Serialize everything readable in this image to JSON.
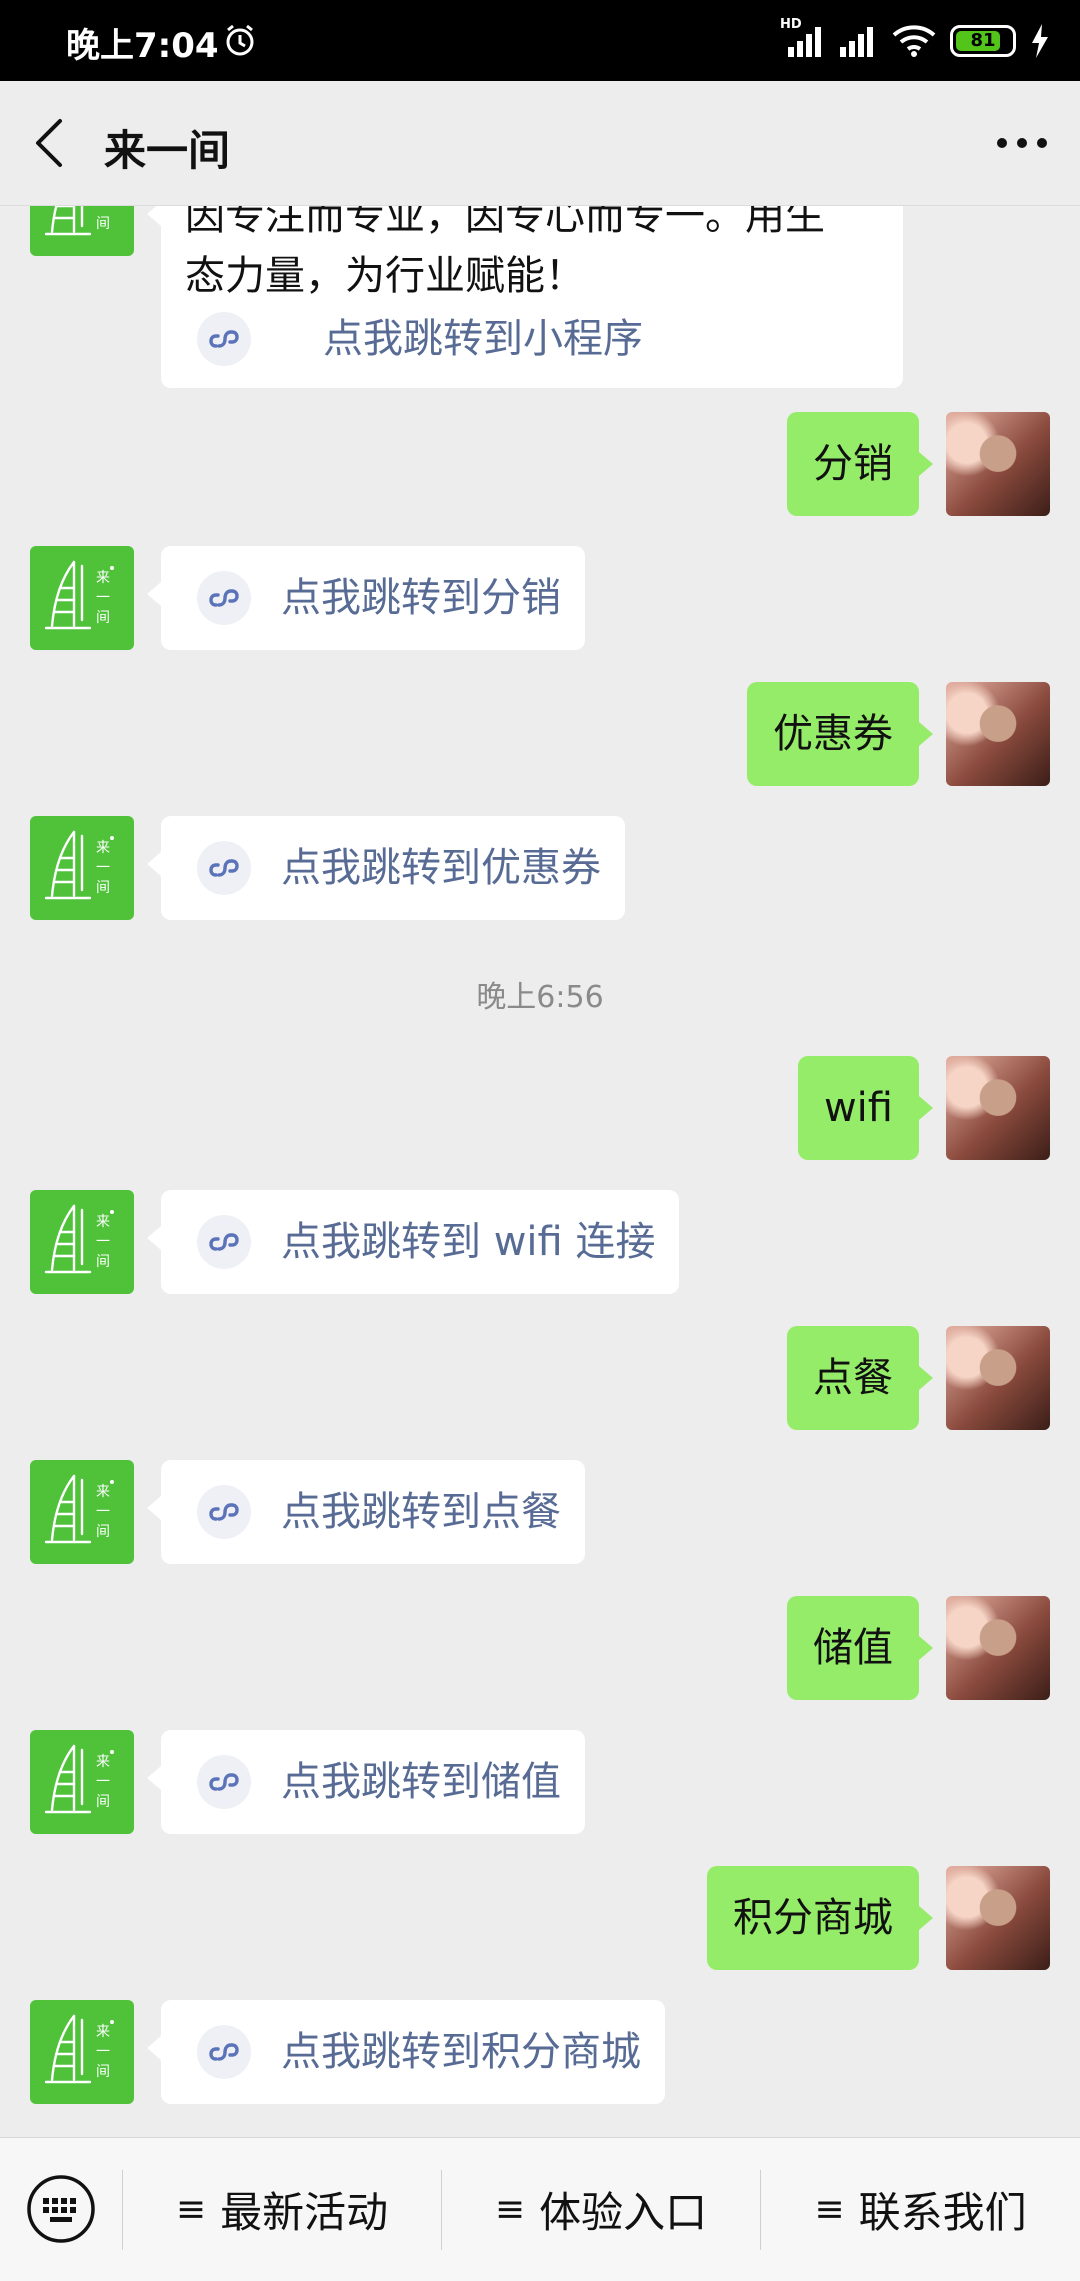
{
  "status_bar": {
    "time": "晚上7:04",
    "network_label": "HD",
    "battery": "81",
    "battery_fraction": 0.81
  },
  "header": {
    "title": "来一间",
    "back_icon": "chevron-left-icon",
    "more_icon": "ellipsis-icon"
  },
  "chat": {
    "intro": {
      "line1": "因专注而专业，因专心而专一。用生",
      "line2": "态力量，为行业赋能！",
      "link": "点我跳转到小程序"
    },
    "messages": [
      {
        "user": "分销",
        "reply": "点我跳转到分销"
      },
      {
        "user": "优惠券",
        "reply": "点我跳转到优惠券"
      },
      {
        "user": "wifi",
        "reply": "点我跳转到 wifi 连接"
      },
      {
        "user": "点餐",
        "reply": "点我跳转到点餐"
      },
      {
        "user": "储值",
        "reply": "点我跳转到储值"
      },
      {
        "user": "积分商城",
        "reply": "点我跳转到积分商城"
      }
    ],
    "timestamp": "晚上6:56",
    "bot_logo_text": "来一间"
  },
  "bottom_menu": {
    "keyboard_icon": "keyboard-icon",
    "items": [
      {
        "label": "最新活动"
      },
      {
        "label": "体验入口"
      },
      {
        "label": "联系我们"
      }
    ],
    "bars_glyph": "≡"
  },
  "colors": {
    "outgoing_bubble": "#95ec69",
    "link_text": "#576b95",
    "bot_avatar": "#4fc23a",
    "background": "#ededed"
  }
}
